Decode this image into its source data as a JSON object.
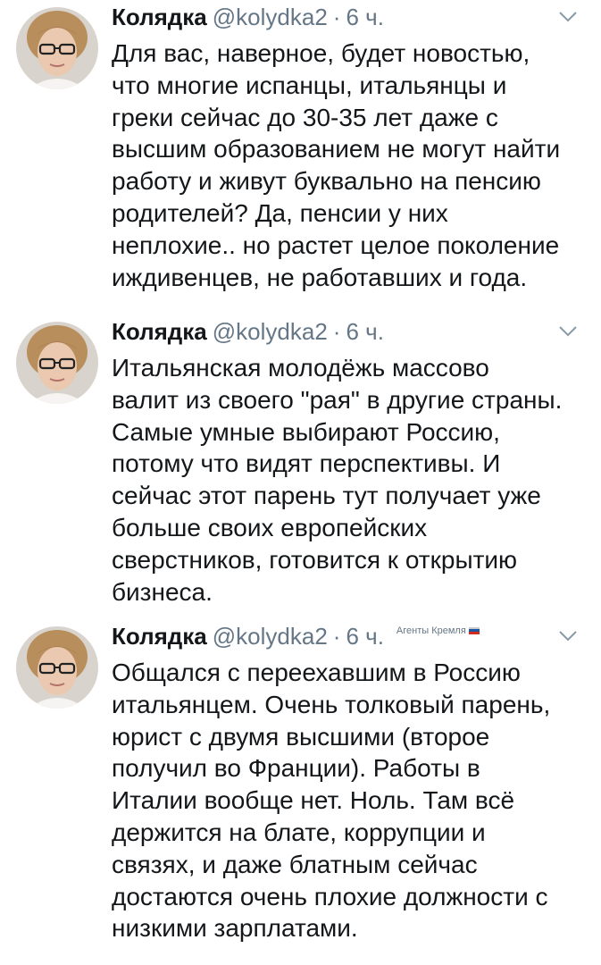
{
  "colors": {
    "text": "#14171a",
    "secondary": "#657786",
    "background": "#ffffff"
  },
  "tweets": [
    {
      "name": "Колядка",
      "handle": "@kolydka2",
      "separator": "·",
      "time": "6 ч.",
      "label": "",
      "text": "Для вас, наверное, будет новостью,\nчто многие испанцы, итальянцы и\nгреки сейчас до 30-35 лет даже с\nвысшим образованием не могут найти\nработу и живут буквально на пенсию\nродителей?  Да, пенсии у них\nнеплохие.. но растет целое поколение\nиждивенцев, не работавших и года."
    },
    {
      "name": "Колядка",
      "handle": "@kolydka2",
      "separator": "·",
      "time": "6 ч.",
      "label": "",
      "text": "Итальянская молодёжь массово\nвалит из своего \"рая\" в другие страны.\nСамые умные выбирают Россию,\nпотому что видят перспективы. И\nсейчас этот парень тут получает уже\nбольше своих европейских\nсверстников, готовится к открытию\nбизнеса."
    },
    {
      "name": "Колядка",
      "handle": "@kolydka2",
      "separator": "·",
      "time": "6 ч.",
      "label": "Агенты Кремля",
      "text": "Общался с переехавшим в Россию\nитальянцем. Очень толковый парень,\nюрист с двумя высшими (второе\nполучил во Франции). Работы в\nИталии вообще нет. Ноль. Там всё\nдержится на блате, коррупции и\nсвязях, и даже блатным сейчас\nдостаются очень плохие должности с\nнизкими зарплатами."
    }
  ]
}
